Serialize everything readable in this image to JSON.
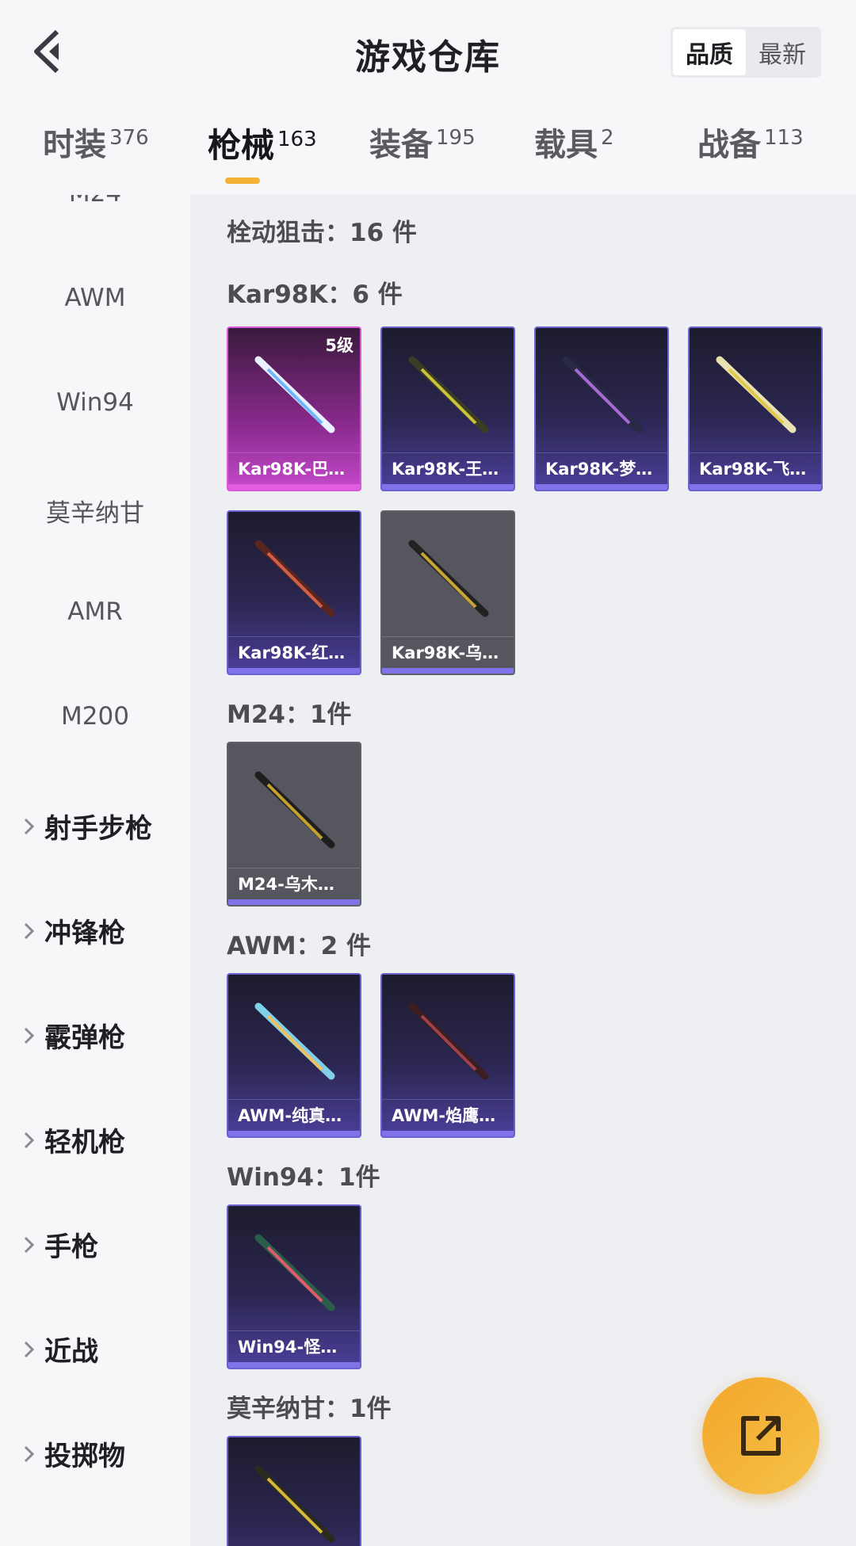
{
  "header": {
    "title": "游戏仓库",
    "sort_options": [
      "品质",
      "最新"
    ],
    "sort_active": "品质"
  },
  "tabs": [
    {
      "label": "时装",
      "count": "376"
    },
    {
      "label": "枪械",
      "count": "163",
      "active": true
    },
    {
      "label": "装备",
      "count": "195"
    },
    {
      "label": "载具",
      "count": "2"
    },
    {
      "label": "战备",
      "count": "113"
    }
  ],
  "sidebar": {
    "partial_item": "M24",
    "items": [
      "AWM",
      "Win94",
      "莫辛纳甘",
      "AMR",
      "M200"
    ],
    "categories": [
      "射手步枪",
      "冲锋枪",
      "霰弹枪",
      "轻机枪",
      "手枪",
      "近战",
      "投掷物"
    ]
  },
  "content": {
    "group_header": "栓动狙击：16 件",
    "sections": [
      {
        "title": "Kar98K：6 件",
        "items": [
          {
            "name": "Kar98K-巴…",
            "level": "5级",
            "rarity": "pink"
          },
          {
            "name": "Kar98K-王…",
            "rarity": "purple"
          },
          {
            "name": "Kar98K-梦…",
            "rarity": "purple"
          },
          {
            "name": "Kar98K-飞…",
            "rarity": "purple"
          },
          {
            "name": "Kar98K-红…",
            "rarity": "purple"
          },
          {
            "name": "Kar98K-乌…",
            "rarity": "grey"
          }
        ]
      },
      {
        "title": "M24：1件",
        "items": [
          {
            "name": "M24-乌木…",
            "rarity": "grey"
          }
        ]
      },
      {
        "title": "AWM：2 件",
        "items": [
          {
            "name": "AWM-纯真…",
            "rarity": "purple"
          },
          {
            "name": "AWM-焰鹰…",
            "rarity": "purple"
          }
        ]
      },
      {
        "title": "Win94：1件",
        "items": [
          {
            "name": "Win94-怪…",
            "rarity": "purple"
          }
        ]
      },
      {
        "title": "莫辛纳甘：1件",
        "items": [
          {
            "name": "",
            "rarity": "purple"
          }
        ]
      }
    ]
  },
  "colors": {
    "accent": "#f5b333",
    "rarity_purple": "#7f73ea",
    "rarity_pink": "#e25ee0",
    "fab": "#f4a62a"
  },
  "icons": {
    "back": "back-arrow-icon",
    "expand": "chevron-right-icon",
    "share": "share-export-icon",
    "gun": "rifle-icon"
  }
}
